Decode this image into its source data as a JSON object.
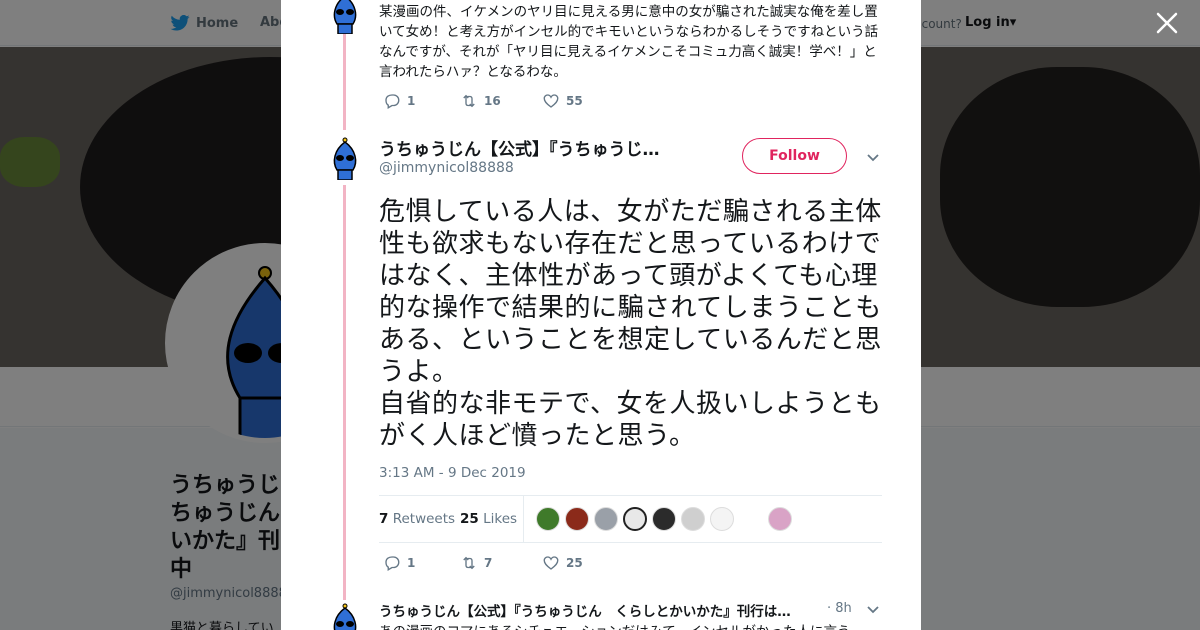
{
  "topbar": {
    "home_label": "Home",
    "about_label": "Abo",
    "account_label": "ccount?",
    "login_label": "Log in"
  },
  "profile": {
    "name": "うちゅうじ\nちゅうじん\nいかた』刊\n中",
    "handle": "@jimmynicol8888",
    "bio": "黒猫と暮らしてい"
  },
  "modal": {
    "previous_tweet": {
      "text": "某漫画の件、イケメンのヤリ目に見える男に意中の女が騙された誠実な俺を差し置いて女め！と考え方がインセル的でキモいというならわかるしそうですねという話なんですが、それが「ヤリ目に見えるイケメンこそコミュ力高く誠実！学べ！」と言われたらハァ？となるわな。",
      "replies": "1",
      "retweets": "16",
      "likes": "55"
    },
    "main_tweet": {
      "name": "うちゅうじん【公式】『うちゅうじ…",
      "handle": "@jimmynicol88888",
      "follow_label": "Follow",
      "text": "危惧している人は、女がただ騙される主体性も欲求もない存在だと思っているわけではなく、主体性があって頭がよくても心理的な操作で結果的に騙されてしまうこともある、ということを想定しているんだと思うよ。\n自省的な非モテで、女を人扱いしようともがく人ほど憤ったと思う。",
      "timestamp": "3:13 AM - 9 Dec 2019",
      "retweet_count": "7",
      "retweet_label": "Retweets",
      "like_count": "25",
      "like_label": "Likes",
      "replies": "1",
      "retweets": "7",
      "likes": "25"
    },
    "reply_tweet": {
      "name": "うちゅうじん【公式】『うちゅうじん　くらしとかいかた』刊行は…",
      "time": "· 8h",
      "text": "あの漫画のコマにあるシチュエーションだけみて、インセルがかった人に言う"
    }
  },
  "colors": {
    "accent": "#e0245e",
    "thread_line": "#f2b4c4",
    "twitter_blue": "#1da1f2",
    "text_secondary": "#657786"
  }
}
